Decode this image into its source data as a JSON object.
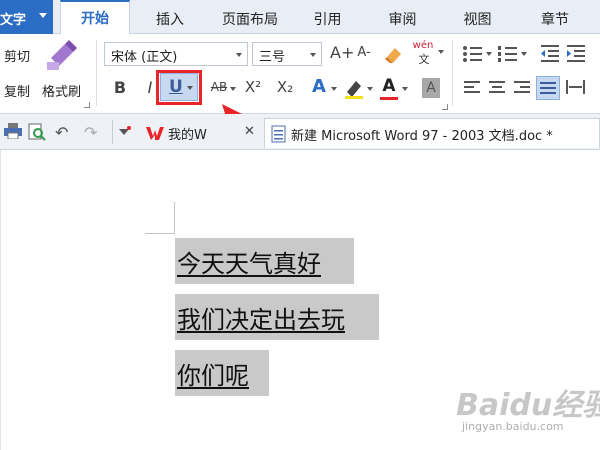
{
  "app": {
    "button_label": "文字"
  },
  "tabs": [
    {
      "label": "开始",
      "active": true
    },
    {
      "label": "插入"
    },
    {
      "label": "页面布局"
    },
    {
      "label": "引用"
    },
    {
      "label": "审阅"
    },
    {
      "label": "视图"
    },
    {
      "label": "章节"
    }
  ],
  "ribbon": {
    "clipboard": {
      "cut": "剪切",
      "copy": "复制",
      "format_painter": "格式刷"
    },
    "font": {
      "family": "宋体 (正文)",
      "size": "三号",
      "grow_label": "A+",
      "shrink_label": "A-",
      "pinyin_label": "wén",
      "bold": "B",
      "italic": "I",
      "underline": "U",
      "strike": "AB",
      "superscript": "X²",
      "subscript": "X₂",
      "text_effect": "A",
      "font_color": "A",
      "char_shade": "A"
    }
  },
  "document_tabs": [
    {
      "label": "我的W"
    },
    {
      "label": "新建 Microsoft Word 97 - 2003 文档.doc *"
    }
  ],
  "document": {
    "lines": [
      "今天天气真好",
      "我们决定出去玩",
      "你们呢"
    ]
  },
  "watermark": {
    "brand": "Baidu经验",
    "url": "jingyan.baidu.com"
  },
  "colors": {
    "accent": "#2b6cc4",
    "highlight": "#e8262a",
    "selection": "#c9c9c9"
  }
}
